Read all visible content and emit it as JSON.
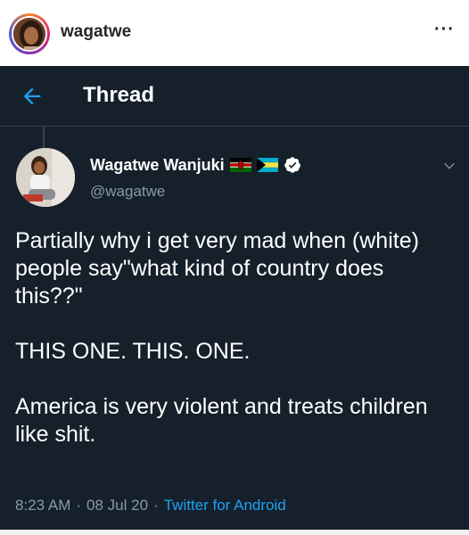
{
  "instagram": {
    "username": "wagatwe",
    "more_icon": "more-horizontal-icon",
    "more_label": "···"
  },
  "twitter": {
    "header": {
      "back_icon": "arrow-left-icon",
      "title": "Thread"
    },
    "tweet": {
      "display_name": "Wagatwe Wanjuki",
      "flags": [
        "kenya-flag-icon",
        "bahamas-flag-icon"
      ],
      "verified_icon": "verified-badge-icon",
      "handle": "@wagatwe",
      "text": "Partially why i get very mad when (white) people say\"what kind of country does this??\"\n\nTHIS ONE. THIS. ONE.\n\nAmerica is very violent and treats children like shit.",
      "time": "8:23 AM",
      "separator": "·",
      "date": "08 Jul 20",
      "source": "Twitter for Android"
    }
  },
  "colors": {
    "twitter_bg": "#15202b",
    "twitter_blue": "#1da1f2",
    "muted_text": "#8899a6",
    "divider": "#38444d"
  }
}
